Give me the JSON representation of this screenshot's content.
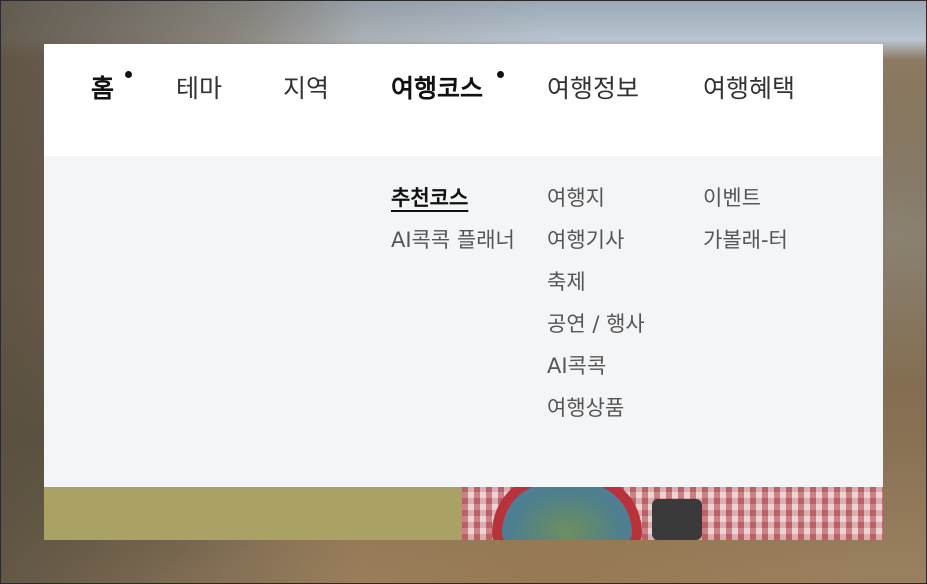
{
  "gnb": {
    "items": [
      {
        "label": "홈",
        "active": true
      },
      {
        "label": "테마"
      },
      {
        "label": "지역"
      },
      {
        "label": "여행코스",
        "active": true
      },
      {
        "label": "여행정보"
      },
      {
        "label": "여행혜택"
      }
    ]
  },
  "submenu": {
    "course": [
      "추천코스",
      "AI콕콕 플래너"
    ],
    "info": [
      "여행지",
      "여행기사",
      "축제",
      "공연 / 행사",
      "AI콕콕",
      "여행상품"
    ],
    "benefit": [
      "이벤트",
      "가볼래-터"
    ]
  },
  "colors": {
    "submenu_bg": "#f4f5f7",
    "banner_olive": "#aaa264"
  }
}
